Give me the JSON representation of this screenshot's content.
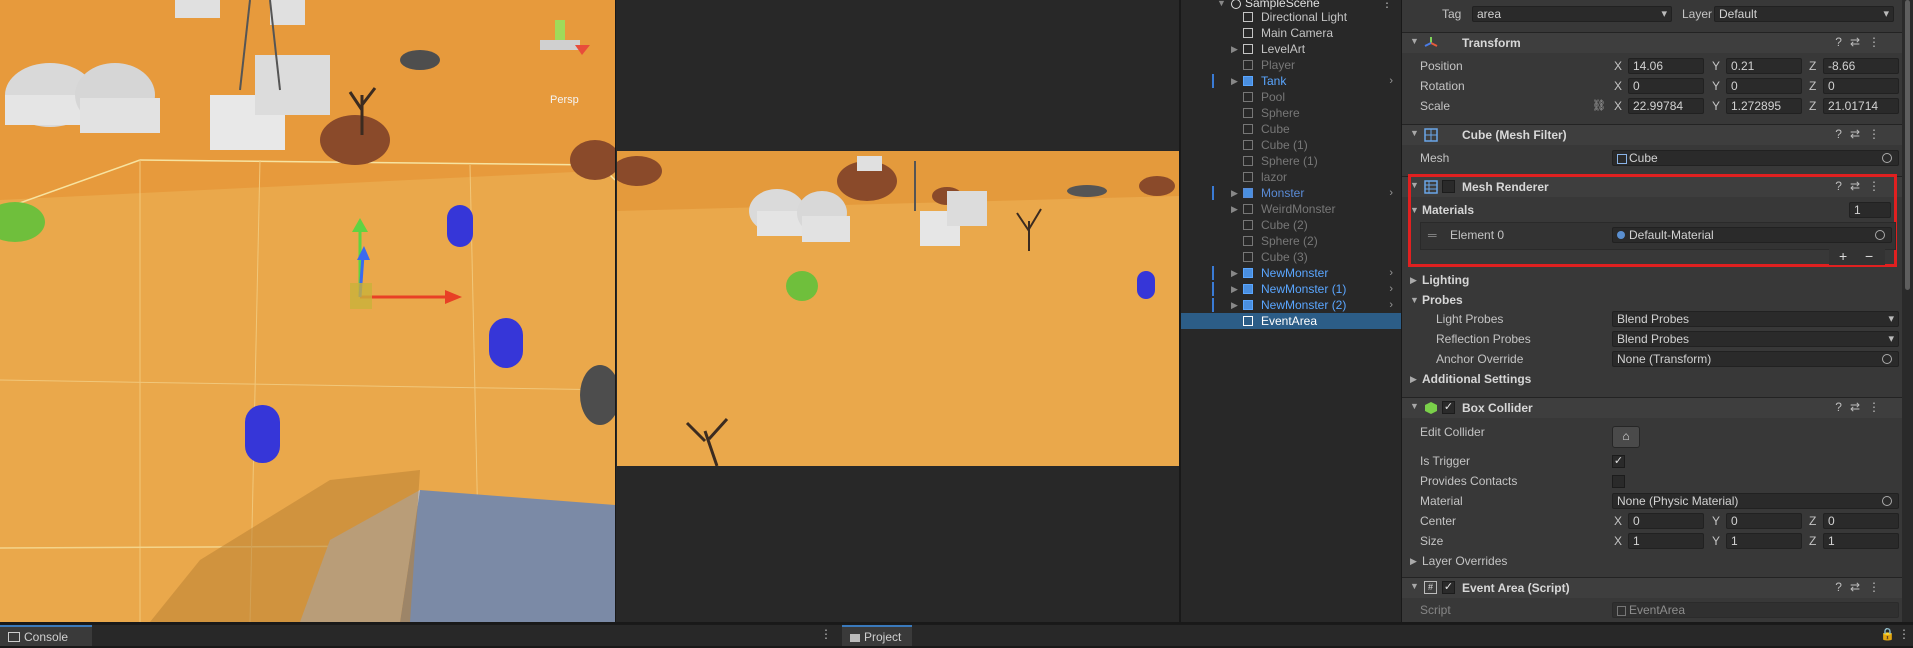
{
  "scene": {
    "persp_label": "Persp"
  },
  "hierarchy": {
    "scene_name": "SampleScene",
    "items": [
      {
        "label": "Directional Light",
        "style": "normal",
        "expandable": false
      },
      {
        "label": "Main Camera",
        "style": "normal",
        "expandable": false
      },
      {
        "label": "LevelArt",
        "style": "normal",
        "expandable": true
      },
      {
        "label": "Player",
        "style": "dim",
        "expandable": false
      },
      {
        "label": "Tank",
        "style": "blue",
        "expandable": true
      },
      {
        "label": "Pool",
        "style": "dim",
        "expandable": false
      },
      {
        "label": "Sphere",
        "style": "dim",
        "expandable": false
      },
      {
        "label": "Cube",
        "style": "dim",
        "expandable": false
      },
      {
        "label": "Cube (1)",
        "style": "dim",
        "expandable": false
      },
      {
        "label": "Sphere (1)",
        "style": "dim",
        "expandable": false
      },
      {
        "label": "lazor",
        "style": "dim",
        "expandable": false
      },
      {
        "label": "Monster",
        "style": "dblue",
        "expandable": true
      },
      {
        "label": "WeirdMonster",
        "style": "dim",
        "expandable": true
      },
      {
        "label": "Cube (2)",
        "style": "dim",
        "expandable": false
      },
      {
        "label": "Sphere (2)",
        "style": "dim",
        "expandable": false
      },
      {
        "label": "Cube (3)",
        "style": "dim",
        "expandable": false
      },
      {
        "label": "NewMonster",
        "style": "blue",
        "expandable": true
      },
      {
        "label": "NewMonster (1)",
        "style": "blue",
        "expandable": true
      },
      {
        "label": "NewMonster (2)",
        "style": "blue",
        "expandable": true
      },
      {
        "label": "EventArea",
        "style": "selected",
        "expandable": false
      }
    ]
  },
  "inspector": {
    "tag_label": "Tag",
    "tag_value": "area",
    "layer_label": "Layer",
    "layer_value": "Default",
    "transform": {
      "title": "Transform",
      "position_label": "Position",
      "rotation_label": "Rotation",
      "scale_label": "Scale",
      "position": {
        "x": "14.06",
        "y": "0.21",
        "z": "-8.66"
      },
      "rotation": {
        "x": "0",
        "y": "0",
        "z": "0"
      },
      "scale": {
        "x": "22.99784",
        "y": "1.272895",
        "z": "21.01714"
      }
    },
    "mesh_filter": {
      "title": "Cube (Mesh Filter)",
      "mesh_label": "Mesh",
      "mesh_value": "Cube"
    },
    "mesh_renderer": {
      "title": "Mesh Renderer",
      "materials_label": "Materials",
      "materials_count": "1",
      "element_label": "Element 0",
      "element_value": "Default-Material",
      "add_label": "+",
      "remove_label": "−",
      "lighting_label": "Lighting",
      "probes_label": "Probes",
      "light_probes_label": "Light Probes",
      "light_probes_value": "Blend Probes",
      "reflection_probes_label": "Reflection Probes",
      "reflection_probes_value": "Blend Probes",
      "anchor_override_label": "Anchor Override",
      "anchor_override_value": "None (Transform)",
      "additional_settings_label": "Additional Settings",
      "highlight_color": "#e02020"
    },
    "box_collider": {
      "title": "Box Collider",
      "edit_collider_label": "Edit Collider",
      "is_trigger_label": "Is Trigger",
      "is_trigger": true,
      "provides_contacts_label": "Provides Contacts",
      "provides_contacts": false,
      "material_label": "Material",
      "material_value": "None (Physic Material)",
      "center_label": "Center",
      "center": {
        "x": "0",
        "y": "0",
        "z": "0"
      },
      "size_label": "Size",
      "size": {
        "x": "1",
        "y": "1",
        "z": "1"
      },
      "layer_overrides_label": "Layer Overrides"
    },
    "event_area": {
      "title": "Event Area (Script)",
      "script_label": "Script",
      "script_value": "EventArea"
    }
  },
  "bottom": {
    "console_tab": "Console",
    "project_tab": "Project"
  }
}
